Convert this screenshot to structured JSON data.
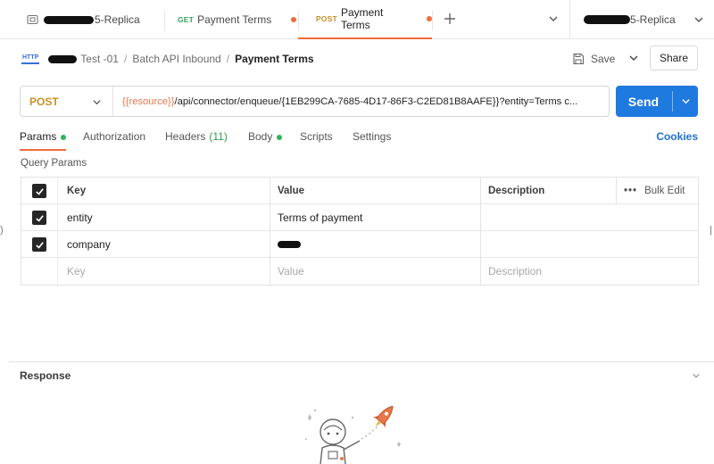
{
  "tabs": [
    {
      "label": "5-Replica"
    },
    {
      "method": "GET",
      "label": "Payment Terms",
      "method_color": "#2fa35c"
    },
    {
      "method": "POST",
      "label": "Payment Terms",
      "method_color": "#c7902a"
    }
  ],
  "workspace": {
    "label": "5-Replica"
  },
  "breadcrumb": {
    "icon_text": "HTTP",
    "part1": "Test -01",
    "part2": "Batch API Inbound",
    "current": "Payment Terms"
  },
  "actions": {
    "save": "Save",
    "share": "Share"
  },
  "request": {
    "method": "POST",
    "url_var": "{{resource}}",
    "url_rest": "/api/connector/enqueue/{1EB299CA-7685-4D17-86F3-C2ED81B8AAFE}}?entity=Terms c...",
    "send": "Send"
  },
  "req_tabs": {
    "params": "Params",
    "authorization": "Authorization",
    "headers": "Headers",
    "headers_count": "(11)",
    "body": "Body",
    "scripts": "Scripts",
    "settings": "Settings",
    "cookies": "Cookies"
  },
  "query_params": {
    "title": "Query Params",
    "columns": {
      "key": "Key",
      "value": "Value",
      "description": "Description",
      "bulk_edit": "Bulk Edit"
    },
    "rows": [
      {
        "key": "entity",
        "value": "Terms of payment",
        "description": ""
      },
      {
        "key": "company",
        "value": "",
        "description": ""
      }
    ],
    "placeholders": {
      "key": "Key",
      "value": "Value",
      "description": "Description"
    }
  },
  "response": {
    "title": "Response"
  },
  "colors": {
    "accent": "#f26b3a",
    "send": "#1f7ae0",
    "post": "#c7902a",
    "link": "#1f6fd1"
  }
}
